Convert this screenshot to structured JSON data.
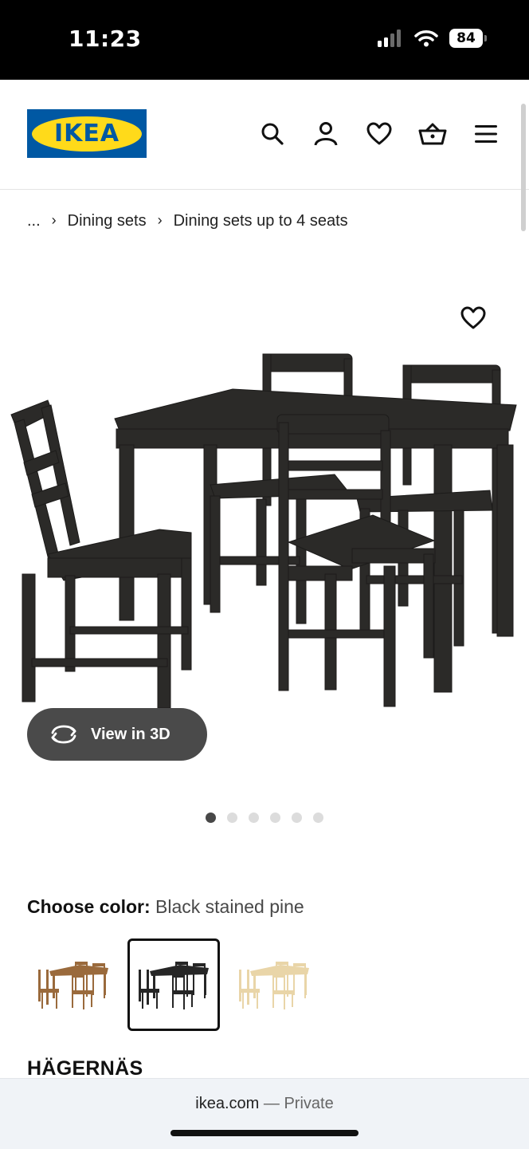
{
  "status_bar": {
    "time": "11:23",
    "battery": "84"
  },
  "header": {
    "logo_text": "IKEA",
    "icons": [
      "search-icon",
      "account-icon",
      "heart-icon",
      "cart-icon",
      "menu-icon"
    ]
  },
  "breadcrumb": {
    "ellipsis": "...",
    "items": [
      "Dining sets",
      "Dining sets up to 4 seats"
    ]
  },
  "gallery": {
    "view_3d_label": "View in 3D",
    "dots_total": 6,
    "active_dot": 1
  },
  "color": {
    "label": "Choose color:",
    "value": "Black stained pine",
    "options": [
      "brown",
      "black",
      "natural"
    ],
    "selected": "black",
    "colors": {
      "brown": "#9a6a3c",
      "black": "#262626",
      "natural": "#e9d5a8"
    }
  },
  "product": {
    "name": "HÄGERNÄS"
  },
  "browser": {
    "url": "ikea.com",
    "mode_separator": "—",
    "mode": "Private"
  }
}
